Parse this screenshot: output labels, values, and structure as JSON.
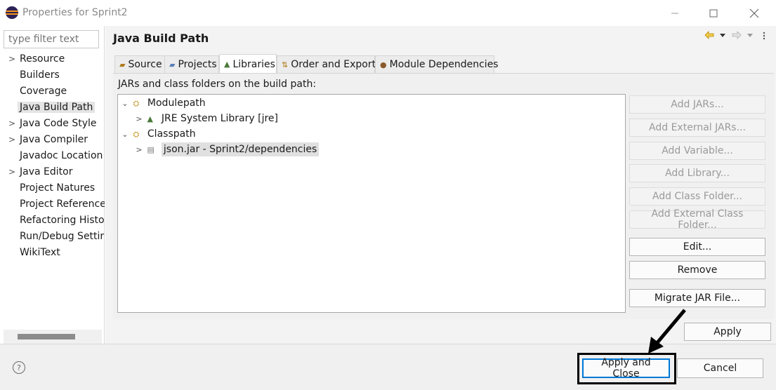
{
  "window": {
    "title": "Properties for Sprint2"
  },
  "filter": {
    "placeholder": "type filter text"
  },
  "sidebar": {
    "items": [
      {
        "label": "Resource",
        "expandable": true
      },
      {
        "label": "Builders",
        "expandable": false
      },
      {
        "label": "Coverage",
        "expandable": false
      },
      {
        "label": "Java Build Path",
        "expandable": false,
        "selected": true
      },
      {
        "label": "Java Code Style",
        "expandable": true
      },
      {
        "label": "Java Compiler",
        "expandable": true
      },
      {
        "label": "Javadoc Location",
        "expandable": false
      },
      {
        "label": "Java Editor",
        "expandable": true
      },
      {
        "label": "Project Natures",
        "expandable": false
      },
      {
        "label": "Project Reference:",
        "expandable": false
      },
      {
        "label": "Refactoring Histo",
        "expandable": false
      },
      {
        "label": "Run/Debug Settir",
        "expandable": false
      },
      {
        "label": "WikiText",
        "expandable": false
      }
    ]
  },
  "page": {
    "title": "Java Build Path"
  },
  "tabs": [
    {
      "label": "Source",
      "icon": "source-folder-icon"
    },
    {
      "label": "Projects",
      "icon": "projects-icon"
    },
    {
      "label": "Libraries",
      "icon": "libraries-icon",
      "active": true
    },
    {
      "label": "Order and Export",
      "icon": "order-export-icon"
    },
    {
      "label": "Module Dependencies",
      "icon": "module-icon"
    }
  ],
  "libraries": {
    "section_label": "JARs and class folders on the build path:",
    "tree": [
      {
        "label": "Modulepath",
        "level": 0,
        "expanded": true
      },
      {
        "label": "JRE System Library [jre]",
        "level": 1,
        "expanded": false
      },
      {
        "label": "Classpath",
        "level": 0,
        "expanded": true
      },
      {
        "label": "json.jar - Sprint2/dependencies",
        "level": 1,
        "expanded": false,
        "selected": true
      }
    ],
    "buttons": {
      "add_jars": "Add JARs...",
      "add_external_jars": "Add External JARs...",
      "add_variable": "Add Variable...",
      "add_library": "Add Library...",
      "add_class_folder": "Add Class Folder...",
      "add_external_class_folder": "Add External Class Folder...",
      "edit": "Edit...",
      "remove": "Remove",
      "migrate_jar": "Migrate JAR File..."
    }
  },
  "footer": {
    "apply": "Apply",
    "apply_and_close": "Apply and Close",
    "cancel": "Cancel",
    "help_glyph": "?"
  },
  "colors": {
    "annotation": "#000000",
    "accent": "#0078d7"
  }
}
